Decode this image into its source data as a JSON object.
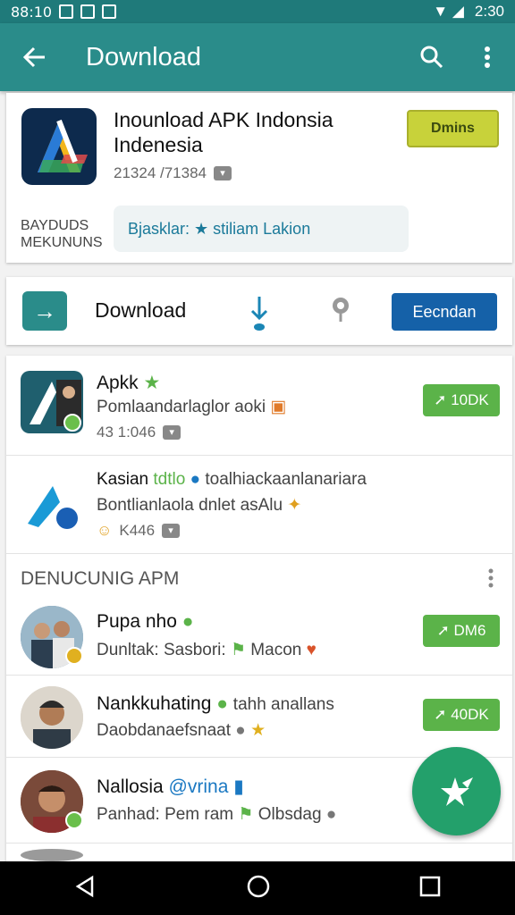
{
  "status_bar": {
    "time": "2:30",
    "left_text": "88:10"
  },
  "app_bar": {
    "title": "Download"
  },
  "app_card": {
    "name": "Inounload APK Indonsia Indenesia",
    "meta": "21324 /71384",
    "install_label": "Dmins",
    "sub_label": "BAYDUDS MEKUNUNS",
    "tags": "Bjasklar: ★ stiliam Lakion"
  },
  "action_row": {
    "label": "Download",
    "button": "Eecndan"
  },
  "list": {
    "items": [
      {
        "title": "Apkk",
        "line2": "Pomlaandarlaglor aoki",
        "line3": "43 1:046",
        "button": "10DK"
      },
      {
        "title": "Kasian",
        "tag": "tdtlo",
        "extra": "toalhiackaanlanariara",
        "line2": "Bontlianlaola dnlet asAlu",
        "line3": "K446",
        "button": ""
      }
    ],
    "section_title": "DENUCUNIG APM",
    "people": [
      {
        "title": "Pupa nho",
        "line2": "Dunltak: Sasbori:",
        "line2b": "Macon",
        "button": "DM6"
      },
      {
        "title": "Nankkuhating",
        "extra": "tahh anallans",
        "line2": "Daobdanaefsnaat",
        "button": "40DK"
      },
      {
        "title": "Nallosia",
        "tag": "@vrina",
        "line2": "Panhad: Pem ram",
        "line2b": "Olbsdag",
        "button": ""
      }
    ]
  },
  "colors": {
    "primary": "#2a8c8a",
    "accent_green": "#5bb349",
    "blue": "#1561a8",
    "fab": "#23a06b"
  }
}
